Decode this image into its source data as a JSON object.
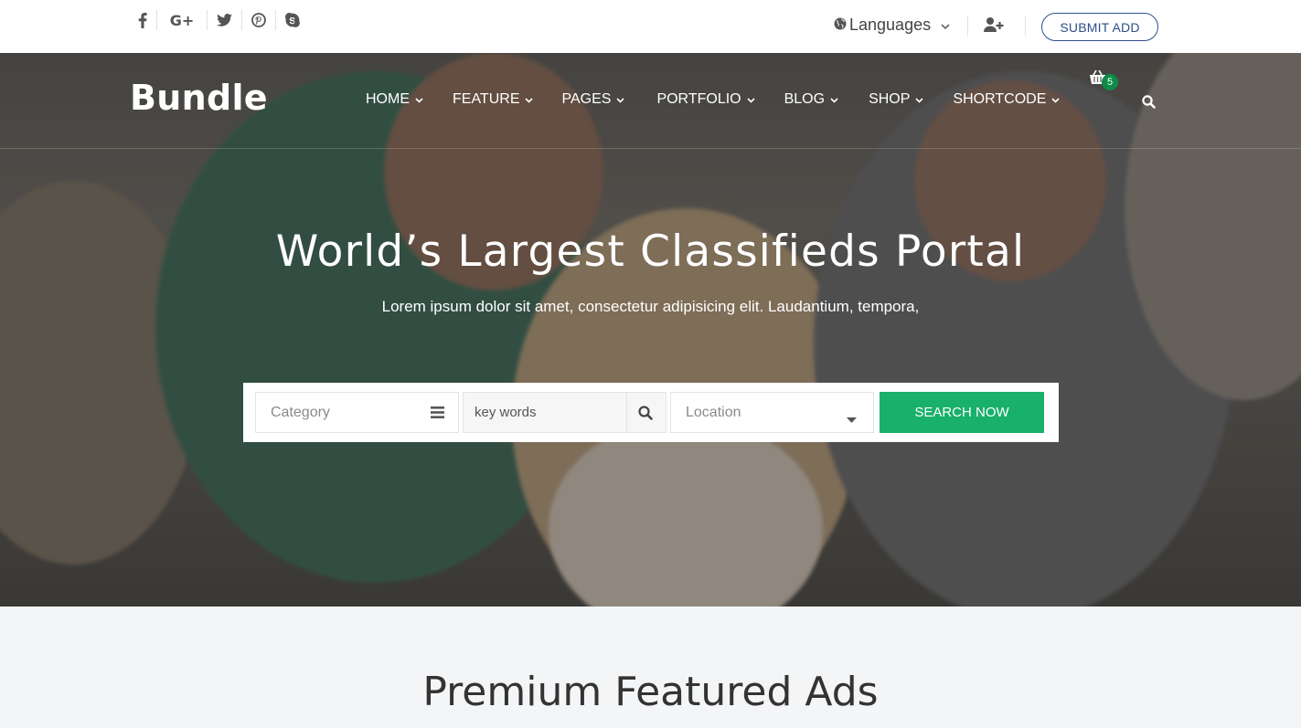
{
  "topbar": {
    "social": [
      {
        "icon": "facebook-icon"
      },
      {
        "icon": "google-plus-icon",
        "glyph": "G+"
      },
      {
        "icon": "twitter-icon"
      },
      {
        "icon": "pinterest-icon"
      },
      {
        "icon": "skype-icon"
      }
    ],
    "languages_label": "Languages",
    "submit_label": "SUBMIT ADD",
    "submit_color": "#2e4f8b"
  },
  "nav": {
    "logo": "Bundle",
    "items": [
      {
        "label": "HOME"
      },
      {
        "label": "FEATURE"
      },
      {
        "label": "PAGES"
      },
      {
        "label": "PORTFOLIO"
      },
      {
        "label": "BLOG"
      },
      {
        "label": "SHOP"
      },
      {
        "label": "SHORTCODE"
      }
    ],
    "cart_count": "5",
    "badge_color": "#0e8c47"
  },
  "hero": {
    "title": "World’s Largest Classifieds Portal",
    "subtitle": "Lorem ipsum dolor sit amet, consectetur adipisicing elit. Laudantium, tempora,"
  },
  "search": {
    "category_placeholder": "Category",
    "keywords_placeholder": "key words",
    "location_placeholder": "Location",
    "button_label": "SEARCH NOW",
    "button_color": "#18b06a"
  },
  "section": {
    "title": "Premium Featured Ads"
  }
}
